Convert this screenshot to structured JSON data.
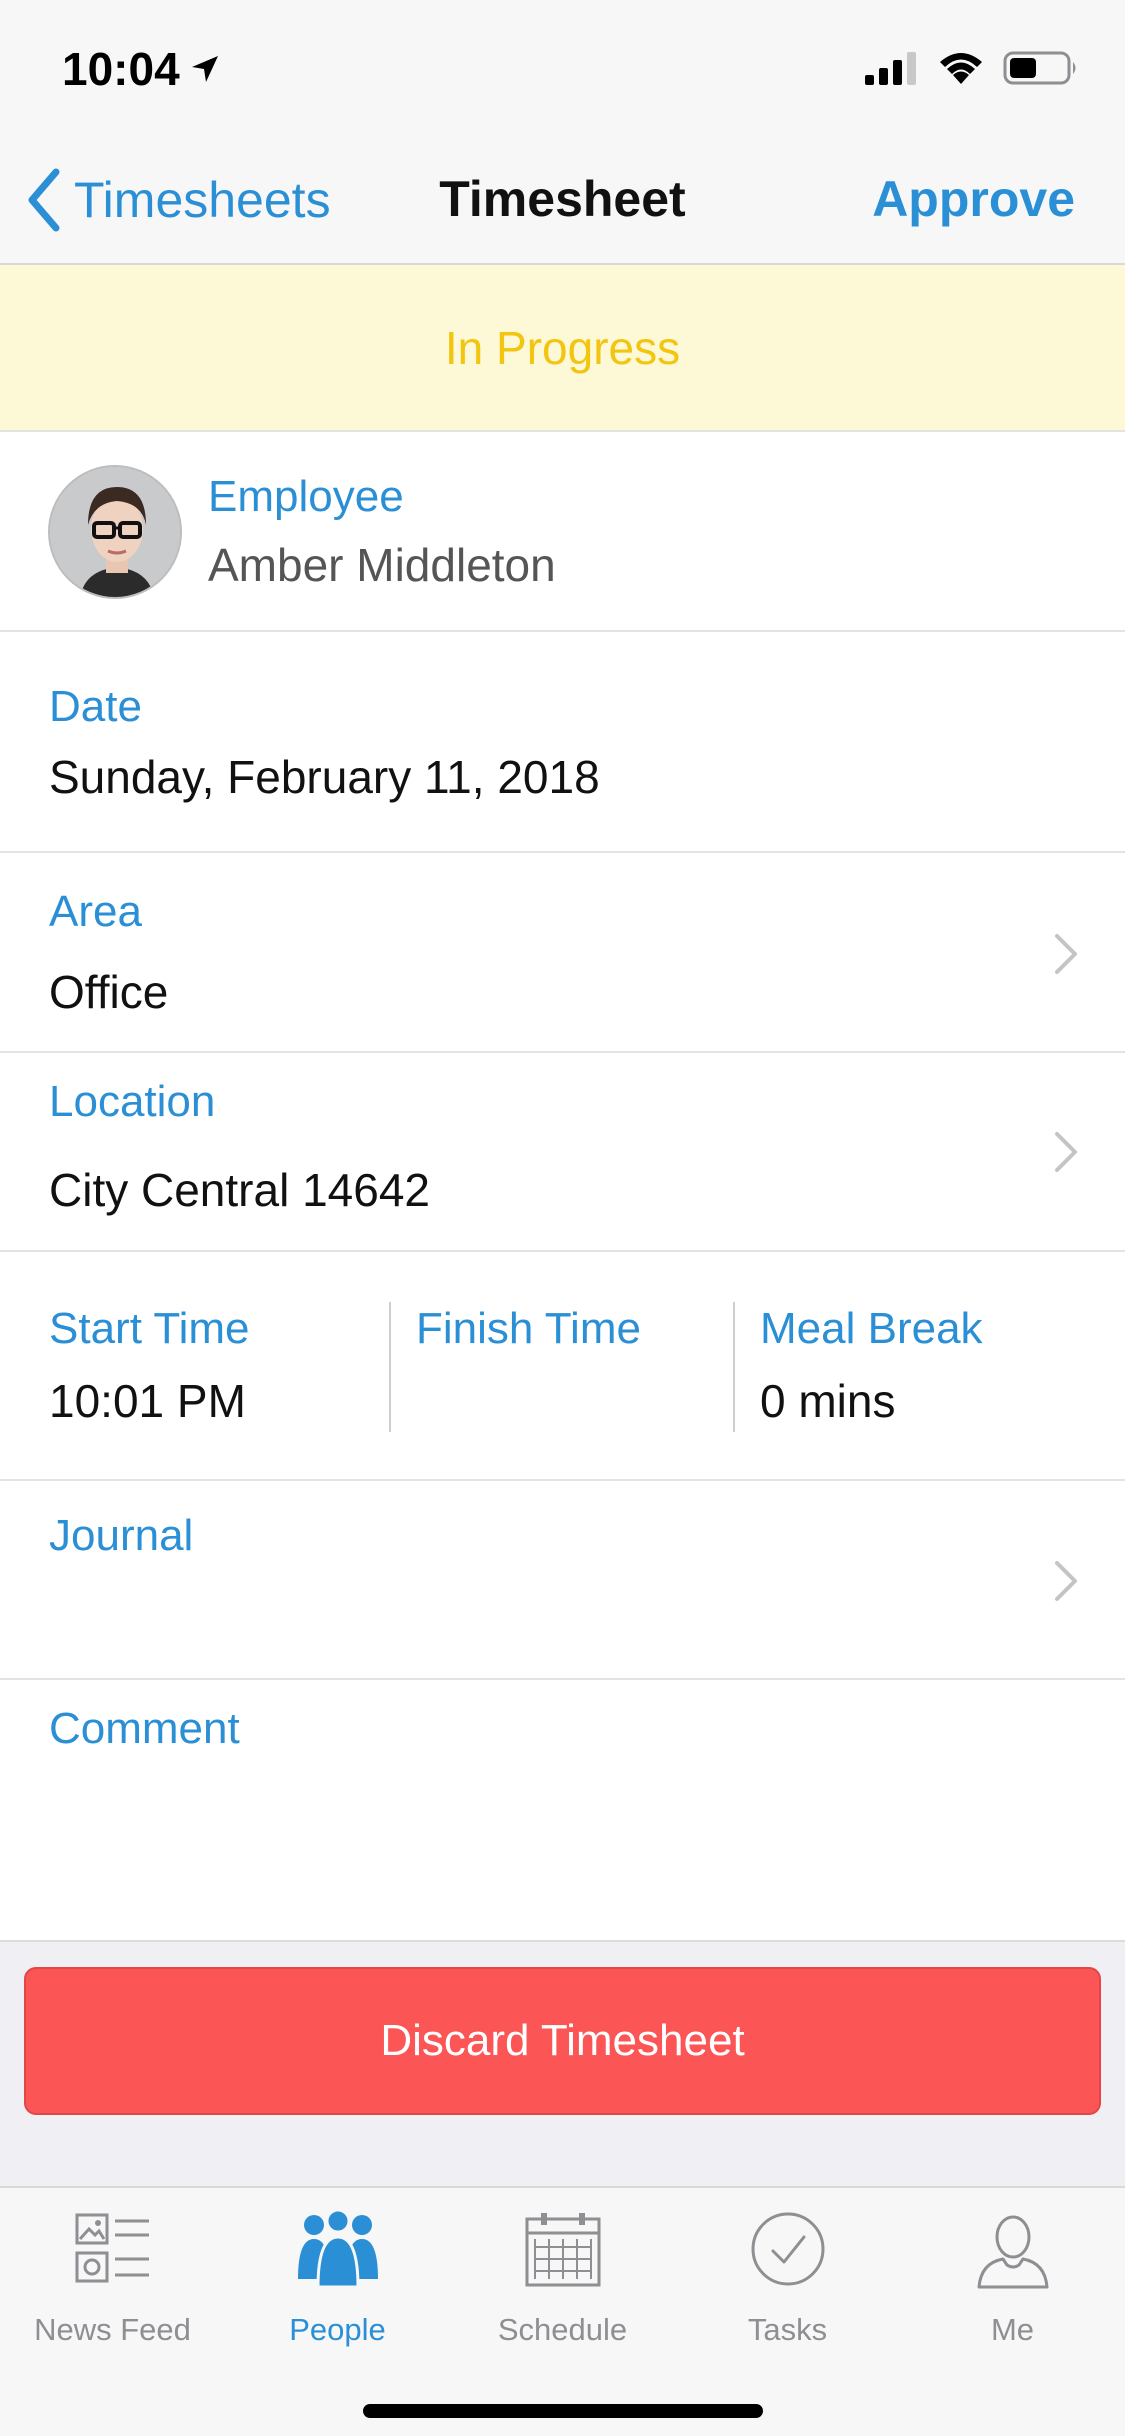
{
  "status_bar": {
    "time": "10:04"
  },
  "nav": {
    "back_label": "Timesheets",
    "title": "Timesheet",
    "action_label": "Approve"
  },
  "banner": {
    "status": "In Progress"
  },
  "employee": {
    "label": "Employee",
    "name": "Amber Middleton"
  },
  "date": {
    "label": "Date",
    "value": "Sunday, February 11, 2018"
  },
  "area": {
    "label": "Area",
    "value": "Office"
  },
  "location": {
    "label": "Location",
    "value": "City Central 14642"
  },
  "times": {
    "start_label": "Start Time",
    "start_value": "10:01 PM",
    "finish_label": "Finish Time",
    "finish_value": "",
    "break_label": "Meal Break",
    "break_value": "0 mins"
  },
  "journal": {
    "label": "Journal"
  },
  "comment": {
    "label": "Comment",
    "value": ""
  },
  "discard_button": "Discard Timesheet",
  "tabs": [
    {
      "label": "News Feed",
      "icon": "news-feed-icon",
      "active": false
    },
    {
      "label": "People",
      "icon": "people-icon",
      "active": true
    },
    {
      "label": "Schedule",
      "icon": "calendar-icon",
      "active": false
    },
    {
      "label": "Tasks",
      "icon": "checkmark-circle-icon",
      "active": false
    },
    {
      "label": "Me",
      "icon": "person-icon",
      "active": false
    }
  ],
  "colors": {
    "accent": "#2b8fd6",
    "banner_bg": "#fdf8d5",
    "banner_text": "#f2c511",
    "danger": "#fb5555",
    "inactive_tab": "#8e8e93"
  }
}
